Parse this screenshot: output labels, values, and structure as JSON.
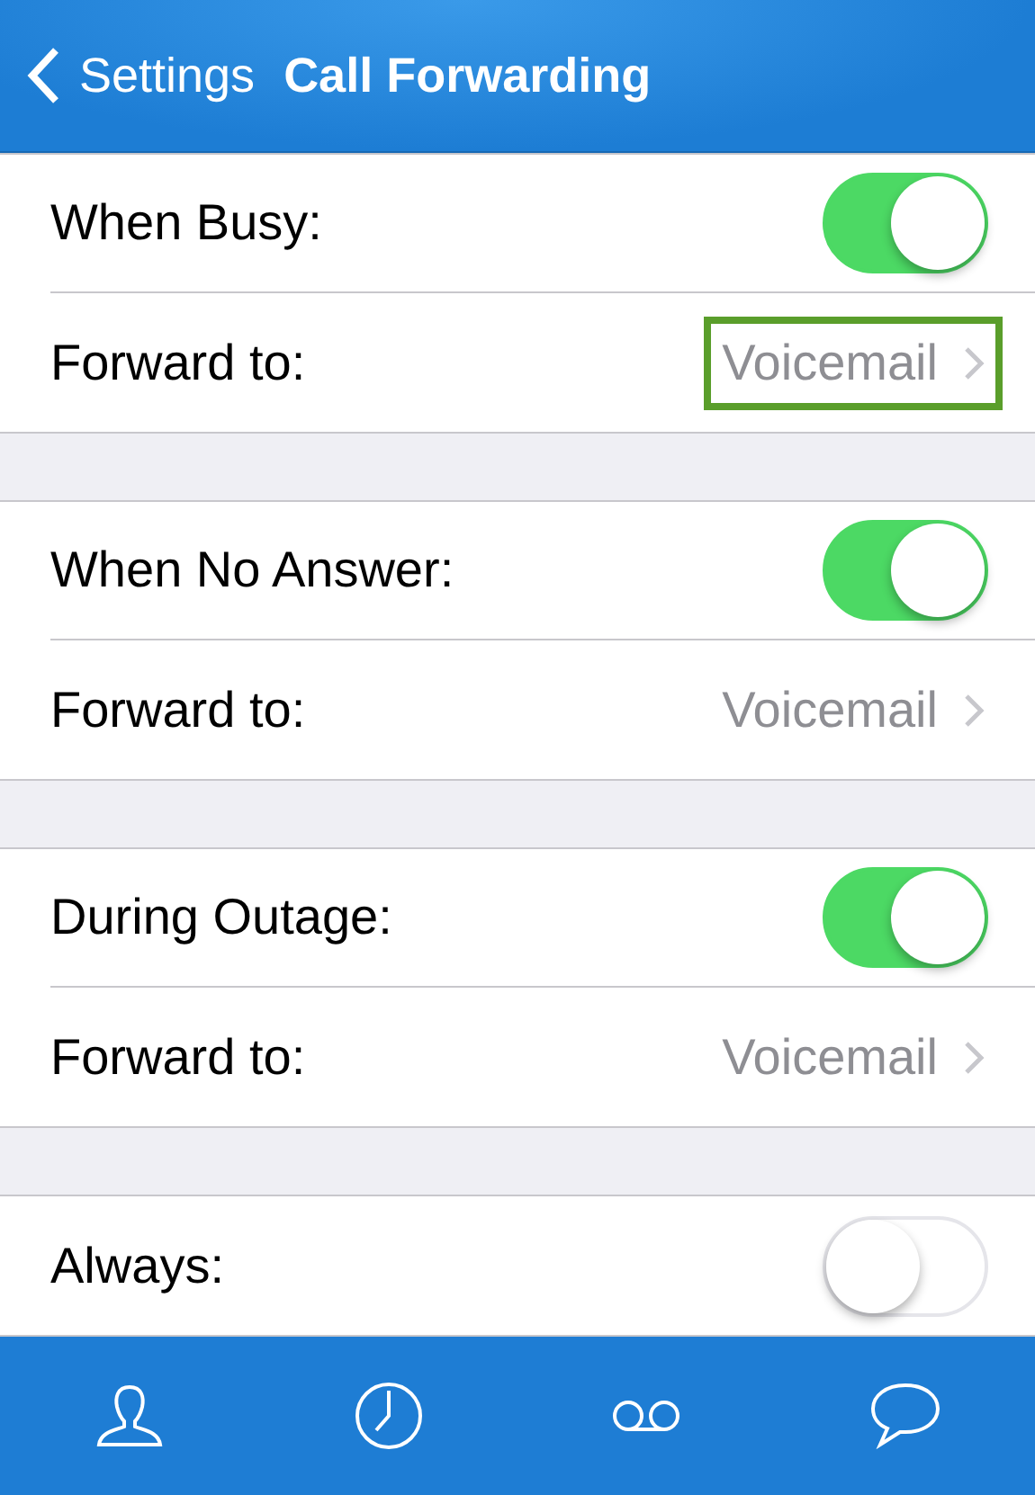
{
  "nav_bar": {
    "back": "Settings",
    "title": "Call Forwarding"
  },
  "sections": [
    {
      "toggle": {
        "label": "When Busy:",
        "on": true
      },
      "forward": {
        "label": "Forward to:",
        "value": "Voicemail",
        "highlighted": true
      }
    },
    {
      "toggle": {
        "label": "When No Answer:",
        "on": true
      },
      "forward": {
        "label": "Forward to:",
        "value": "Voicemail",
        "highlighted": false
      }
    },
    {
      "toggle": {
        "label": "During Outage:",
        "on": true
      },
      "forward": {
        "label": "Forward to:",
        "value": "Voicemail",
        "highlighted": false
      }
    },
    {
      "toggle": {
        "label": "Always:",
        "on": false
      }
    }
  ]
}
